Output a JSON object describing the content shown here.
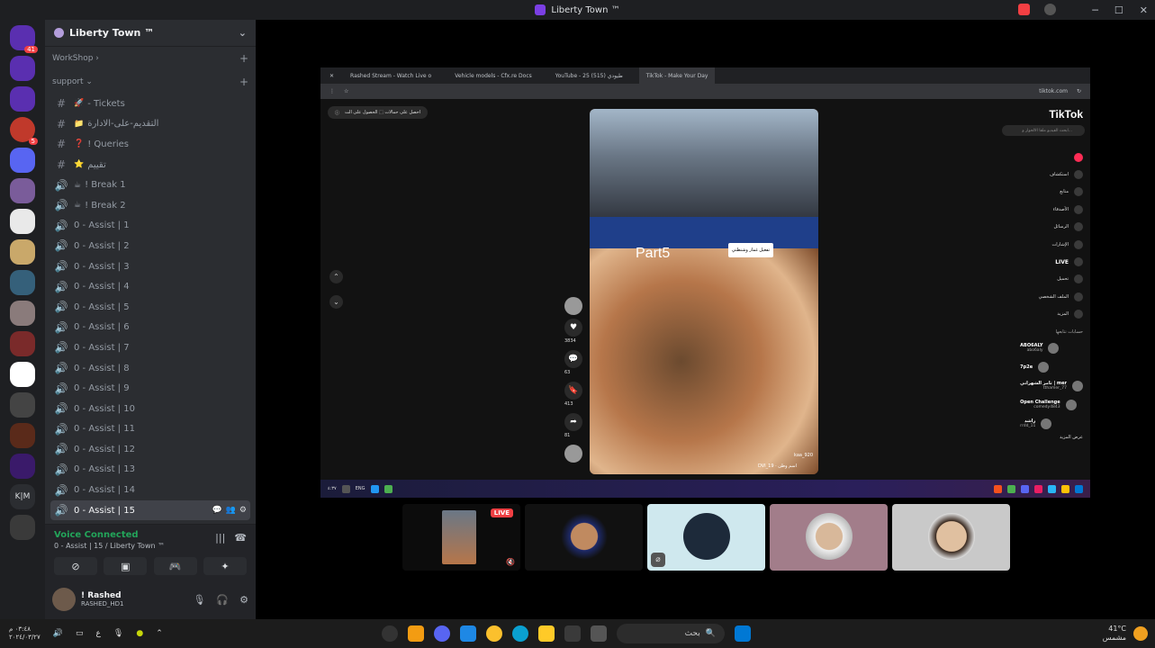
{
  "window": {
    "title": "Liberty Town ™"
  },
  "server": {
    "name": "Liberty Town ™"
  },
  "categories": [
    {
      "label": "WorkShop"
    },
    {
      "label": "support"
    }
  ],
  "channels": [
    {
      "icon": "#",
      "emoji": "🚀",
      "label": "- Tickets"
    },
    {
      "icon": "#",
      "emoji": "📁",
      "label": "التقديم-على-الادارة"
    },
    {
      "icon": "#",
      "emoji": "❓",
      "label": "! Queries"
    },
    {
      "icon": "#",
      "emoji": "⭐",
      "label": "تقييم"
    },
    {
      "icon": "🔊",
      "emoji": "☕",
      "label": "! Break 1"
    },
    {
      "icon": "🔊",
      "emoji": "☕",
      "label": "! Break 2"
    },
    {
      "icon": "🔊",
      "emoji": "",
      "label": "0 - Assist | 1"
    },
    {
      "icon": "🔊",
      "emoji": "",
      "label": "0 - Assist | 2"
    },
    {
      "icon": "🔊",
      "emoji": "",
      "label": "0 - Assist | 3"
    },
    {
      "icon": "🔊",
      "emoji": "",
      "label": "0 - Assist | 4"
    },
    {
      "icon": "🔊",
      "emoji": "",
      "label": "0 - Assist | 5"
    },
    {
      "icon": "🔊",
      "emoji": "",
      "label": "0 - Assist | 6"
    },
    {
      "icon": "🔊",
      "emoji": "",
      "label": "0 - Assist | 7"
    },
    {
      "icon": "🔊",
      "emoji": "",
      "label": "0 - Assist | 8"
    },
    {
      "icon": "🔊",
      "emoji": "",
      "label": "0 - Assist | 9"
    },
    {
      "icon": "🔊",
      "emoji": "",
      "label": "0 - Assist | 10"
    },
    {
      "icon": "🔊",
      "emoji": "",
      "label": "0 - Assist | 11"
    },
    {
      "icon": "🔊",
      "emoji": "",
      "label": "0 - Assist | 12"
    },
    {
      "icon": "🔊",
      "emoji": "",
      "label": "0 - Assist | 13"
    },
    {
      "icon": "🔊",
      "emoji": "",
      "label": "0 - Assist | 14"
    }
  ],
  "active_channel": {
    "label": "0 - Assist | 15"
  },
  "voice": {
    "status": "Voice Connected",
    "location": "0 - Assist | 15 / Liberty Town ™"
  },
  "user": {
    "name": "! Rashed",
    "tag": "RASHED_HD1"
  },
  "browser": {
    "tabs": [
      "Rashed Stream - Watch Live o",
      "Vehicle models - Cfx.re Docs",
      "YouTube - 25 طيودي (515)",
      "TikTok - Make Your Day"
    ],
    "url": "tiktok.com",
    "login_pill": "احصل على حمالات ⬚ الحصول على الت"
  },
  "video": {
    "overlay_text": "Part5",
    "sticker": "تفعيل غماز وشنطتي",
    "user": "kaa_920",
    "caption": "DVI_19 · اسم وطن"
  },
  "video_actions": [
    {
      "name": "like",
      "glyph": "♥",
      "count": "3834"
    },
    {
      "name": "comment",
      "glyph": "💬",
      "count": "63"
    },
    {
      "name": "bookmark",
      "glyph": "🔖",
      "count": "413"
    },
    {
      "name": "share",
      "glyph": "➦",
      "count": "81"
    }
  ],
  "tiktok": {
    "logo": "TikTok",
    "search_placeholder": "ابحث الفيديو ملقا الالحوار و...",
    "nav": [
      "",
      "استكشاف",
      "متابع",
      "الأصدقاء",
      "الرسائل",
      "الإشارات",
      "LIVE",
      "تحميل",
      "الملف الشخصي",
      "المزيد"
    ],
    "following_header": "حسابات تتابعها",
    "following": [
      {
        "name": "ABO6ALY",
        "handle": "abo6aly"
      },
      {
        "name": "7p2e",
        "handle": ""
      },
      {
        "name": "تامر الشهراني | mer",
        "handle": "tthamer_77"
      },
      {
        "name": "Open Challenge",
        "handle": "comedy4843"
      },
      {
        "name": "راشد",
        "handle": "rrdd_11"
      }
    ],
    "see_more": "عرض المزيد"
  },
  "stream_tile": {
    "live_label": "LIVE"
  },
  "taskbar": {
    "clock_time": "٠٣:٤٨ م",
    "clock_date": "٢٠٢٤/٠٣/٢٧",
    "search_label": "بحث",
    "weather_temp": "41°C",
    "weather_desc": "مشمس"
  },
  "colors": {
    "accent": "#5865f2",
    "voice_green": "#23a55a",
    "live_red": "#f23f43",
    "sidebar": "#2b2d31"
  }
}
